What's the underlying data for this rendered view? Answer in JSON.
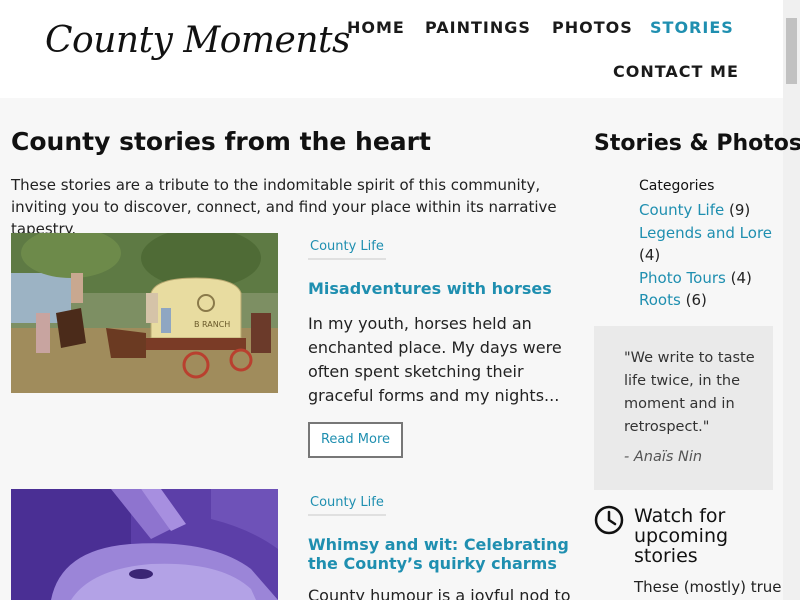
{
  "site": {
    "logo": "County Moments"
  },
  "nav": {
    "items": [
      {
        "label": "HOME"
      },
      {
        "label": "PAINTINGS"
      },
      {
        "label": "PHOTOS"
      },
      {
        "label": "STORIES",
        "active": true
      },
      {
        "label": "CONTACT ME"
      }
    ],
    "active_color": "#1f8fb0"
  },
  "main": {
    "title": "County stories from the heart",
    "intro": "These stories are a tribute to the indomitable spirit of this community, inviting you to discover, connect, and find your place within its narrative tapestry.",
    "posts": [
      {
        "category": "County Life",
        "title": "Misadventures with horses",
        "excerpt": "In my youth, horses held an enchanted place. My days were often spent sketching their graceful forms and my nights...",
        "read_more": "Read More",
        "image_wagon_sign": "B RANCH"
      },
      {
        "category": "County Life",
        "title": "Whimsy and wit: Celebrating the County’s quirky charms",
        "excerpt": "County humour is a joyful nod to"
      }
    ]
  },
  "sidebar": {
    "title": "Stories & Photos",
    "categories_heading": "Categories",
    "categories": [
      {
        "name": "County Life",
        "count": "(9)"
      },
      {
        "name": "Legends and Lore",
        "count": "(4)"
      },
      {
        "name": "Photo Tours",
        "count": "(4)"
      },
      {
        "name": "Roots",
        "count": "(6)"
      }
    ],
    "quote": {
      "text": "\"We write to taste life twice, in the moment and in retrospect.\"",
      "author": "- Anaïs Nin"
    },
    "watch": {
      "title": "Watch for upcoming stories",
      "text": "These (mostly) true"
    }
  }
}
